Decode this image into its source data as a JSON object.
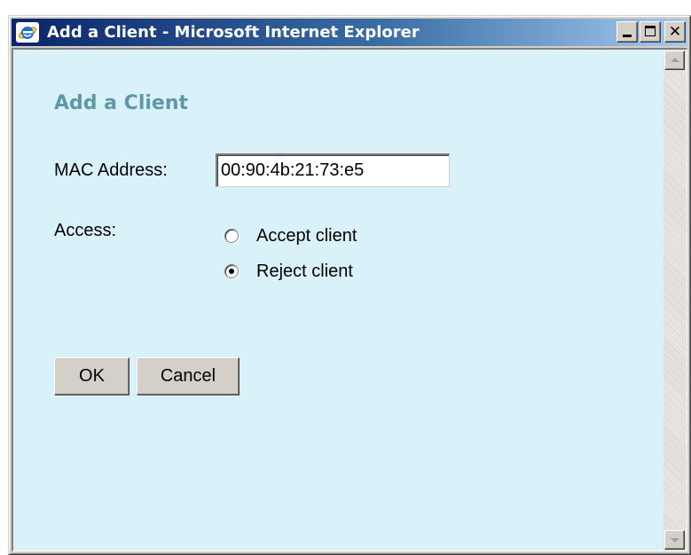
{
  "window": {
    "title": "Add a Client - Microsoft Internet Explorer",
    "icon": "internet-explorer-icon",
    "buttons": [
      "minimize-icon",
      "maximize-icon",
      "close-icon"
    ],
    "close_glyph": "✕"
  },
  "form": {
    "heading": "Add a Client",
    "mac_label": "MAC Address:",
    "mac_value": "00:90:4b:21:73:e5",
    "access_label": "Access:",
    "options": [
      {
        "label": "Accept client",
        "checked": false
      },
      {
        "label": "Reject client",
        "checked": true
      }
    ],
    "ok_label": "OK",
    "cancel_label": "Cancel"
  },
  "colors": {
    "page_background": "#d9f2fa",
    "heading": "#5e97a8",
    "titlebar_start": "#0a246a",
    "titlebar_end": "#a6caf0"
  }
}
